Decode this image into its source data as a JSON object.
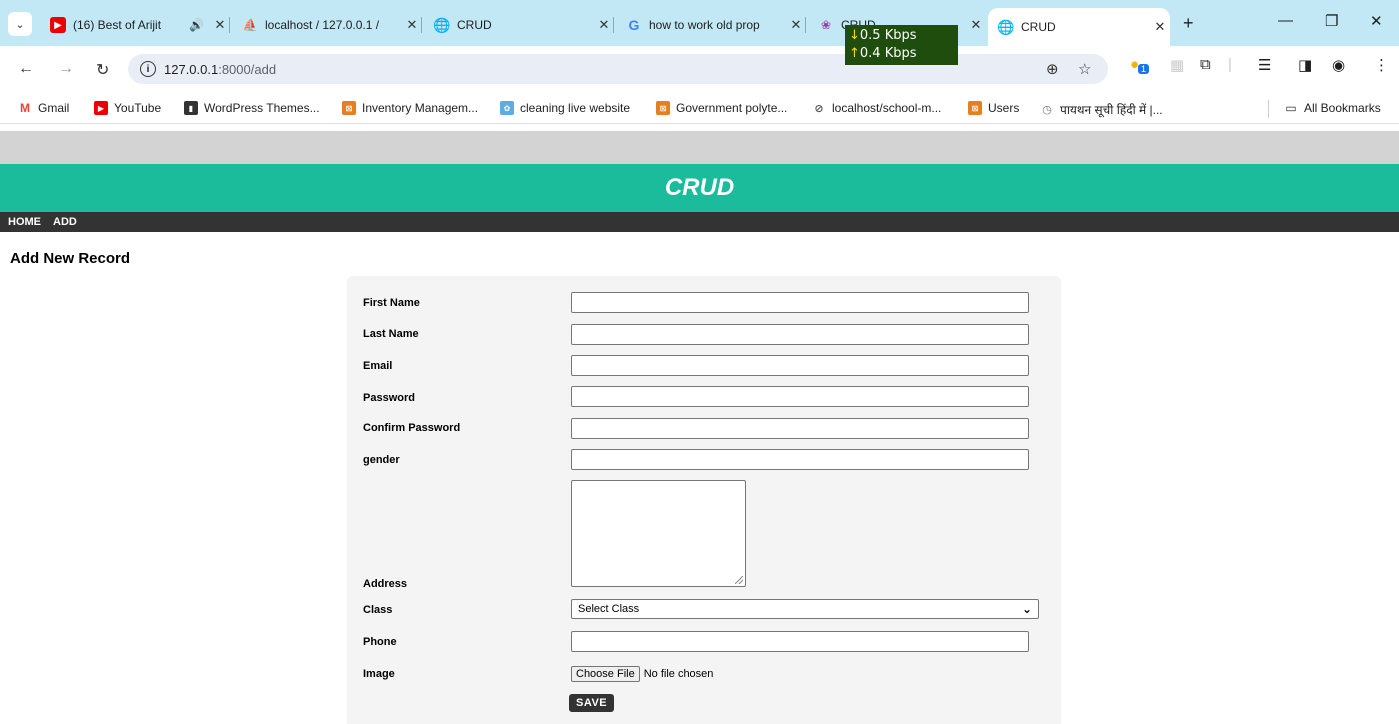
{
  "browser": {
    "tabs": [
      {
        "title": "(16) Best of Arijit",
        "icon": "youtube-icon",
        "audio": true,
        "active": false
      },
      {
        "title": "localhost / 127.0.0.1 /",
        "icon": "phpmyadmin-icon",
        "active": false
      },
      {
        "title": "CRUD",
        "icon": "globe-icon",
        "active": false
      },
      {
        "title": "how to work old prop",
        "icon": "google-icon",
        "active": false
      },
      {
        "title": "CRUD",
        "icon": "lotus-icon",
        "active": false
      },
      {
        "title": "CRUD",
        "icon": "globe-icon",
        "active": true
      }
    ],
    "net_speed": {
      "down": "0.5 Kbps",
      "up": "0.4 Kbps"
    },
    "url_host": "127.0.0.1",
    "url_path": ":8000/add",
    "bookmarks": [
      {
        "label": "Gmail"
      },
      {
        "label": "YouTube"
      },
      {
        "label": "WordPress Themes..."
      },
      {
        "label": "Inventory Managem..."
      },
      {
        "label": "cleaning live website"
      },
      {
        "label": "Government polyte..."
      },
      {
        "label": "localhost/school-m..."
      },
      {
        "label": "Users"
      },
      {
        "label": "पायथन सूची हिंदी में |..."
      }
    ],
    "all_bookmarks": "All Bookmarks",
    "extension_badge": "1"
  },
  "site": {
    "title": "CRUD",
    "menu": {
      "home": "HOME",
      "add": "ADD"
    },
    "page_title": "Add New Record"
  },
  "form": {
    "labels": {
      "first_name": "First Name",
      "last_name": "Last Name",
      "email": "Email",
      "password": "Password",
      "confirm_password": "Confirm Password",
      "gender": "gender",
      "address": "Address",
      "class": "Class",
      "phone": "Phone",
      "image": "Image"
    },
    "class_select": "Select Class",
    "file_button": "Choose File",
    "file_status": "No file chosen",
    "save": "SAVE"
  }
}
